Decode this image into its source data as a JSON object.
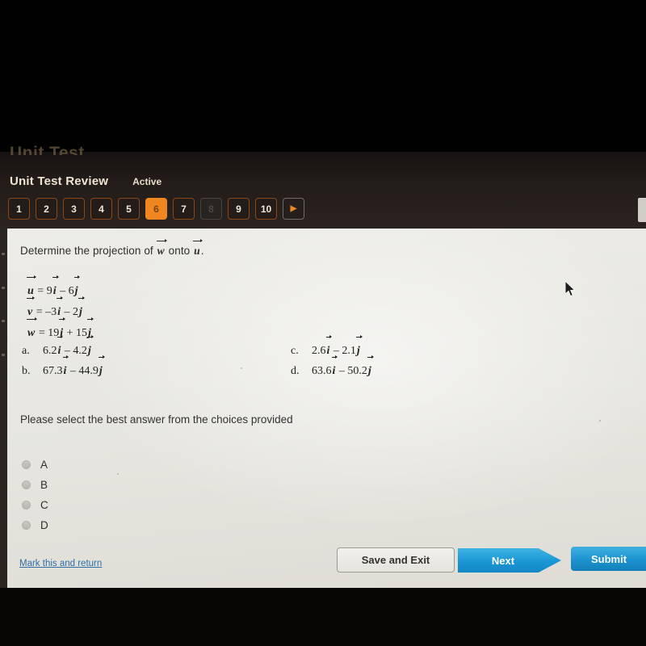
{
  "chrome": {
    "cut_off_title": "Unit Test",
    "title": "Unit Test Review",
    "status": "Active",
    "accent_color": "#ef8620",
    "questions": [
      {
        "label": "1",
        "state": "normal"
      },
      {
        "label": "2",
        "state": "normal"
      },
      {
        "label": "3",
        "state": "normal"
      },
      {
        "label": "4",
        "state": "normal"
      },
      {
        "label": "5",
        "state": "normal"
      },
      {
        "label": "6",
        "state": "active"
      },
      {
        "label": "7",
        "state": "normal"
      },
      {
        "label": "8",
        "state": "disabled"
      },
      {
        "label": "9",
        "state": "normal"
      },
      {
        "label": "10",
        "state": "normal"
      },
      {
        "label": "▶",
        "state": "nextarrow"
      }
    ]
  },
  "question": {
    "prompt_before": "Determine the projection of ",
    "prompt_vector_1": "w",
    "prompt_middle": " onto ",
    "prompt_vector_2": "u",
    "prompt_after": ".",
    "given": [
      {
        "lhs": "u",
        "eq": " = 9",
        "v1": "i",
        "mid": " – 6",
        "v2": "j"
      },
      {
        "lhs": "v",
        "eq": " = –3",
        "v1": "i",
        "mid": " – 2",
        "v2": "j"
      },
      {
        "lhs": "w",
        "eq": " = 19",
        "v1": "i",
        "mid": " + 15",
        "v2": "j"
      }
    ],
    "choices_left": [
      {
        "label": "a.",
        "coef1": "6.2",
        "v1": "i",
        "mid": " – 4.2",
        "v2": "j"
      },
      {
        "label": "b.",
        "coef1": "67.3",
        "v1": "i",
        "mid": " – 44.9",
        "v2": "j"
      }
    ],
    "choices_right": [
      {
        "label": "c.",
        "coef1": "2.6",
        "v1": "i",
        "mid": " – 2.1",
        "v2": "j"
      },
      {
        "label": "d.",
        "coef1": "63.6",
        "v1": "i",
        "mid": " – 50.2",
        "v2": "j"
      }
    ],
    "instruction": "Please select the best answer from the choices provided",
    "options": [
      {
        "label": "A",
        "selected": false
      },
      {
        "label": "B",
        "selected": false
      },
      {
        "label": "C",
        "selected": false
      },
      {
        "label": "D",
        "selected": false
      }
    ]
  },
  "actions": {
    "mark_link": "Mark this and return",
    "save_label": "Save and Exit",
    "next_label": "Next",
    "submit_label": "Submit",
    "primary_color": "#1a96d4"
  }
}
